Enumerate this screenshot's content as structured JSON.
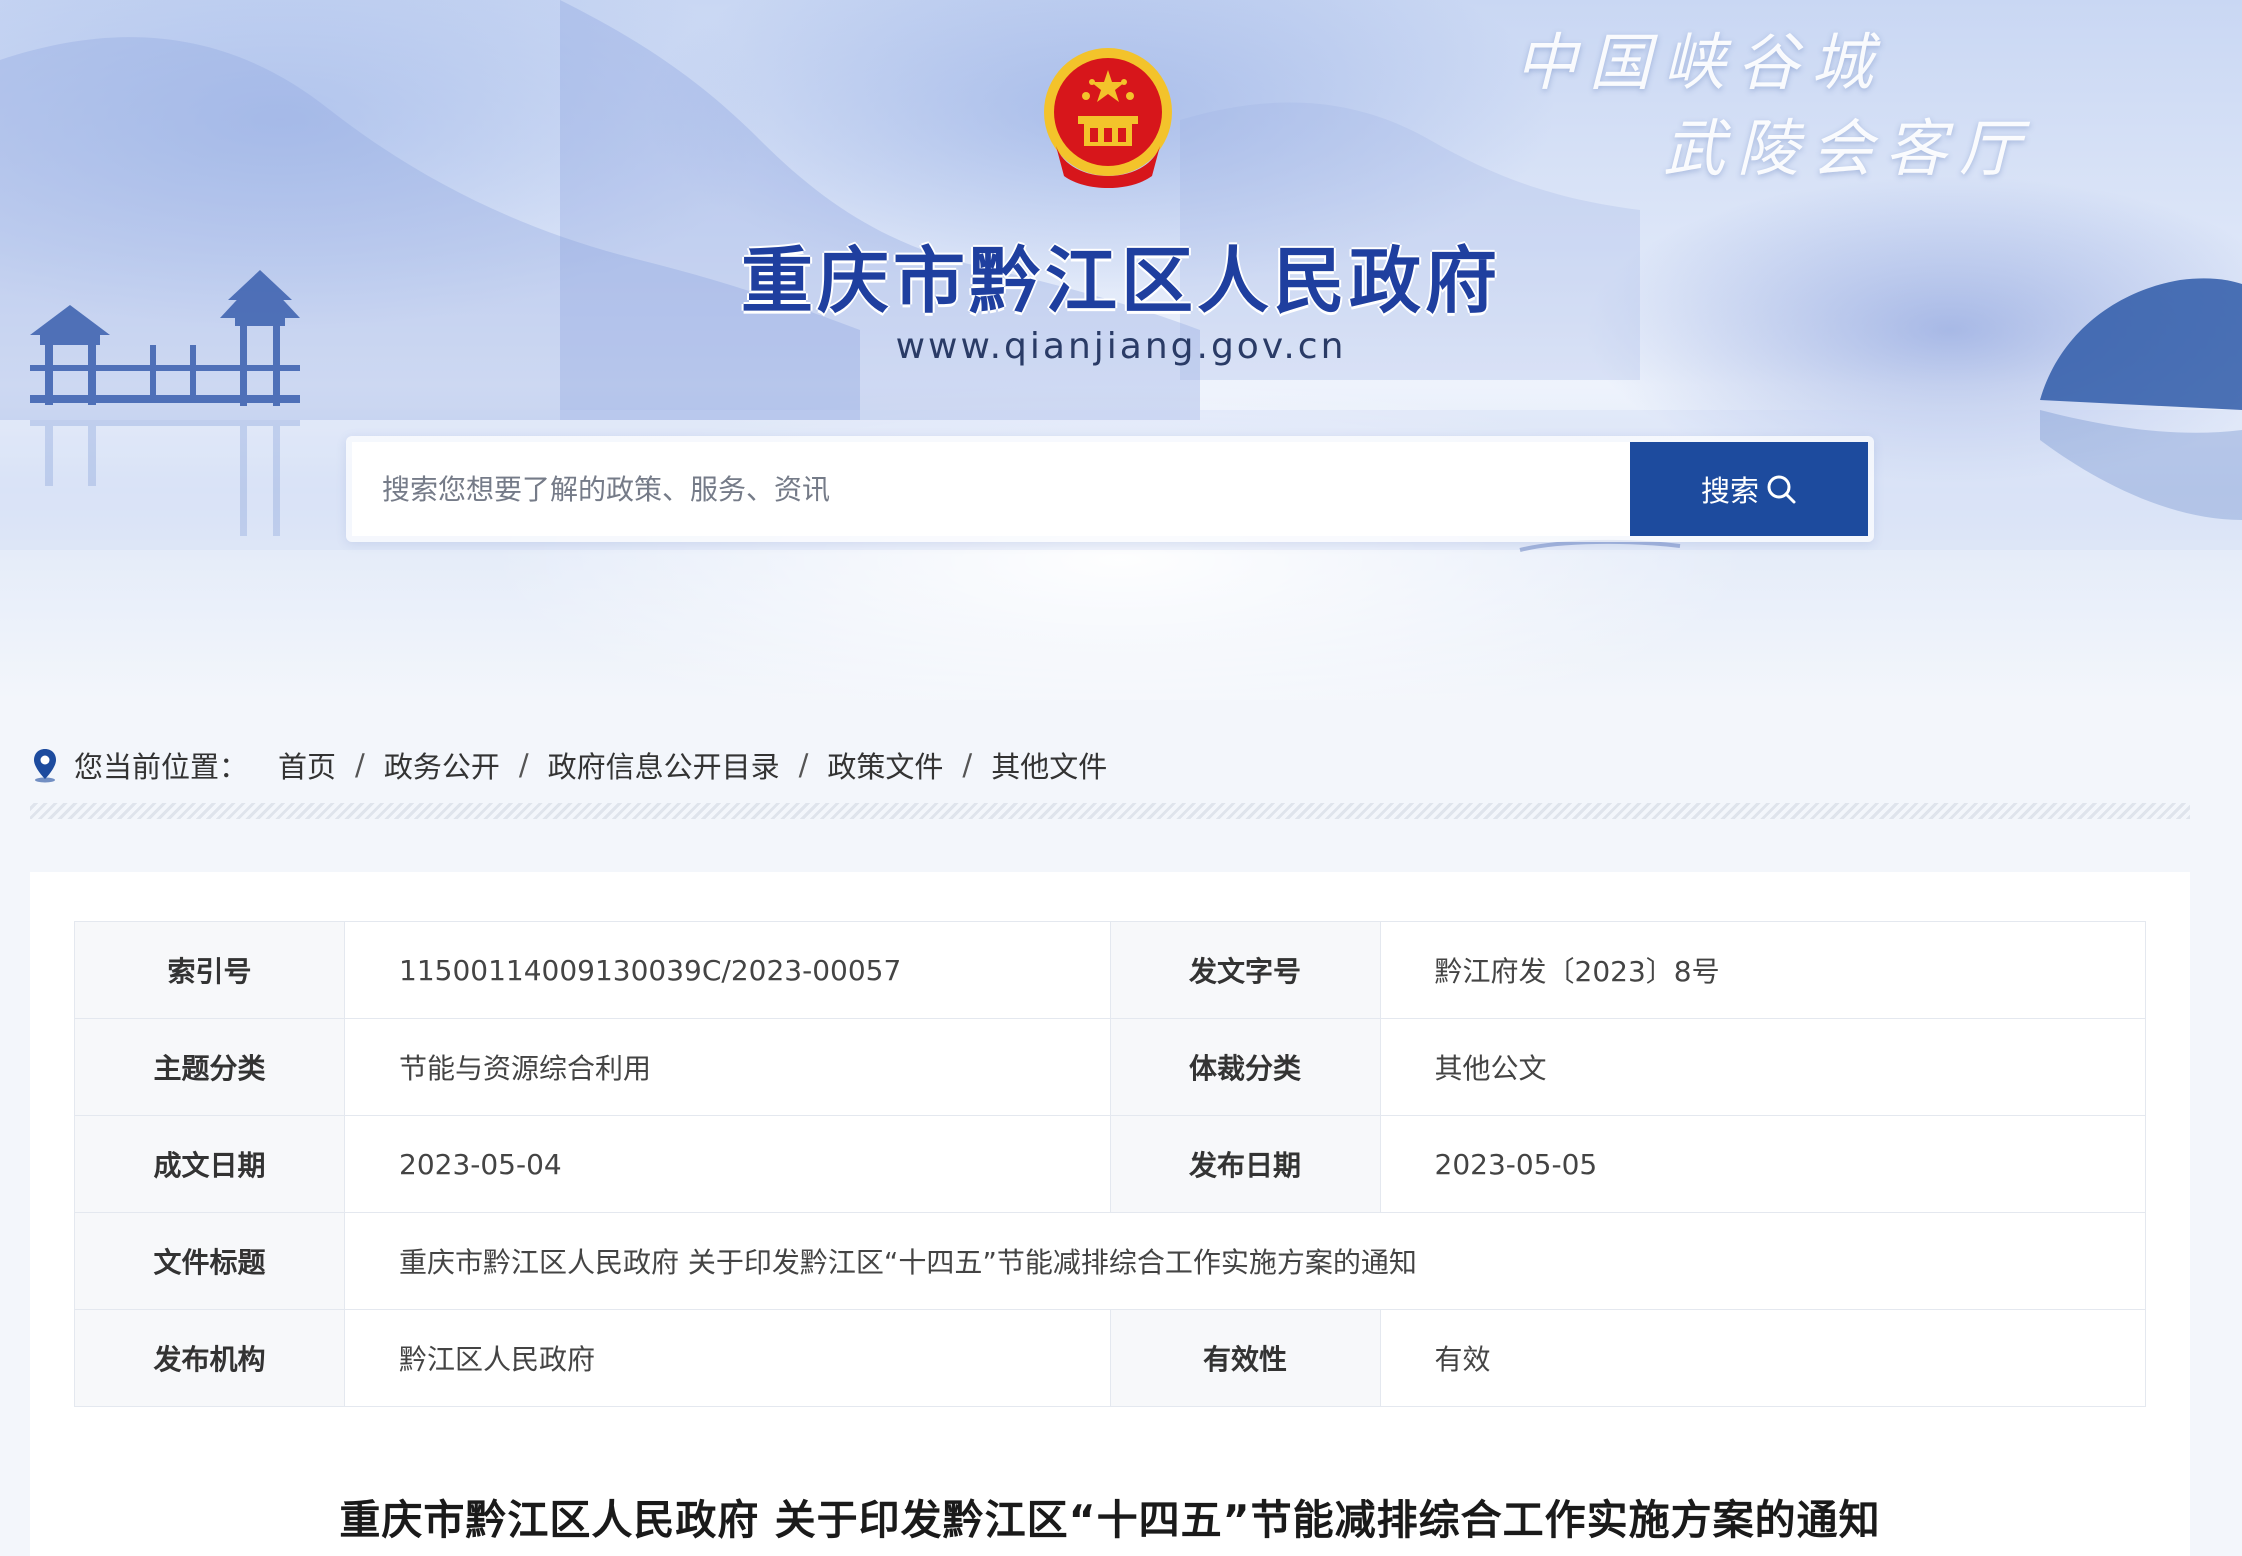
{
  "header": {
    "site_name": "重庆市黔江区人民政府",
    "site_url": "www.qianjiang.gov.cn",
    "slogan_line1": "中国峡谷城",
    "slogan_line2": "武陵会客厅",
    "emblem_icon": "national-emblem-icon"
  },
  "search": {
    "placeholder": "搜索您想要了解的政策、服务、资讯",
    "button_label": "搜索"
  },
  "breadcrumb": {
    "label": "您当前位置：",
    "items": [
      "首页",
      "政务公开",
      "政府信息公开目录",
      "政策文件",
      "其他文件"
    ],
    "separator": "/"
  },
  "meta": {
    "index_no_label": "索引号",
    "index_no": "11500114009130039C/2023-00057",
    "doc_no_label": "发文字号",
    "doc_no": "黔江府发〔2023〕8号",
    "topic_label": "主题分类",
    "topic": "节能与资源综合利用",
    "genre_label": "体裁分类",
    "genre": "其他公文",
    "written_label": "成文日期",
    "written": "2023-05-04",
    "published_label": "发布日期",
    "published": "2023-05-05",
    "title_label": "文件标题",
    "title": "重庆市黔江区人民政府 关于印发黔江区“十四五”节能减排综合工作实施方案的通知",
    "issuer_label": "发布机构",
    "issuer": "黔江区人民政府",
    "validity_label": "有效性",
    "validity": "有效"
  },
  "document": {
    "title": "重庆市黔江区人民政府 关于印发黔江区“十四五”节能减排综合工作实施方案的通知"
  },
  "colors": {
    "brand_blue": "#1d4b9e",
    "title_blue": "#1f3f9f",
    "emblem_red": "#d7161b",
    "emblem_gold": "#f3c32b"
  }
}
